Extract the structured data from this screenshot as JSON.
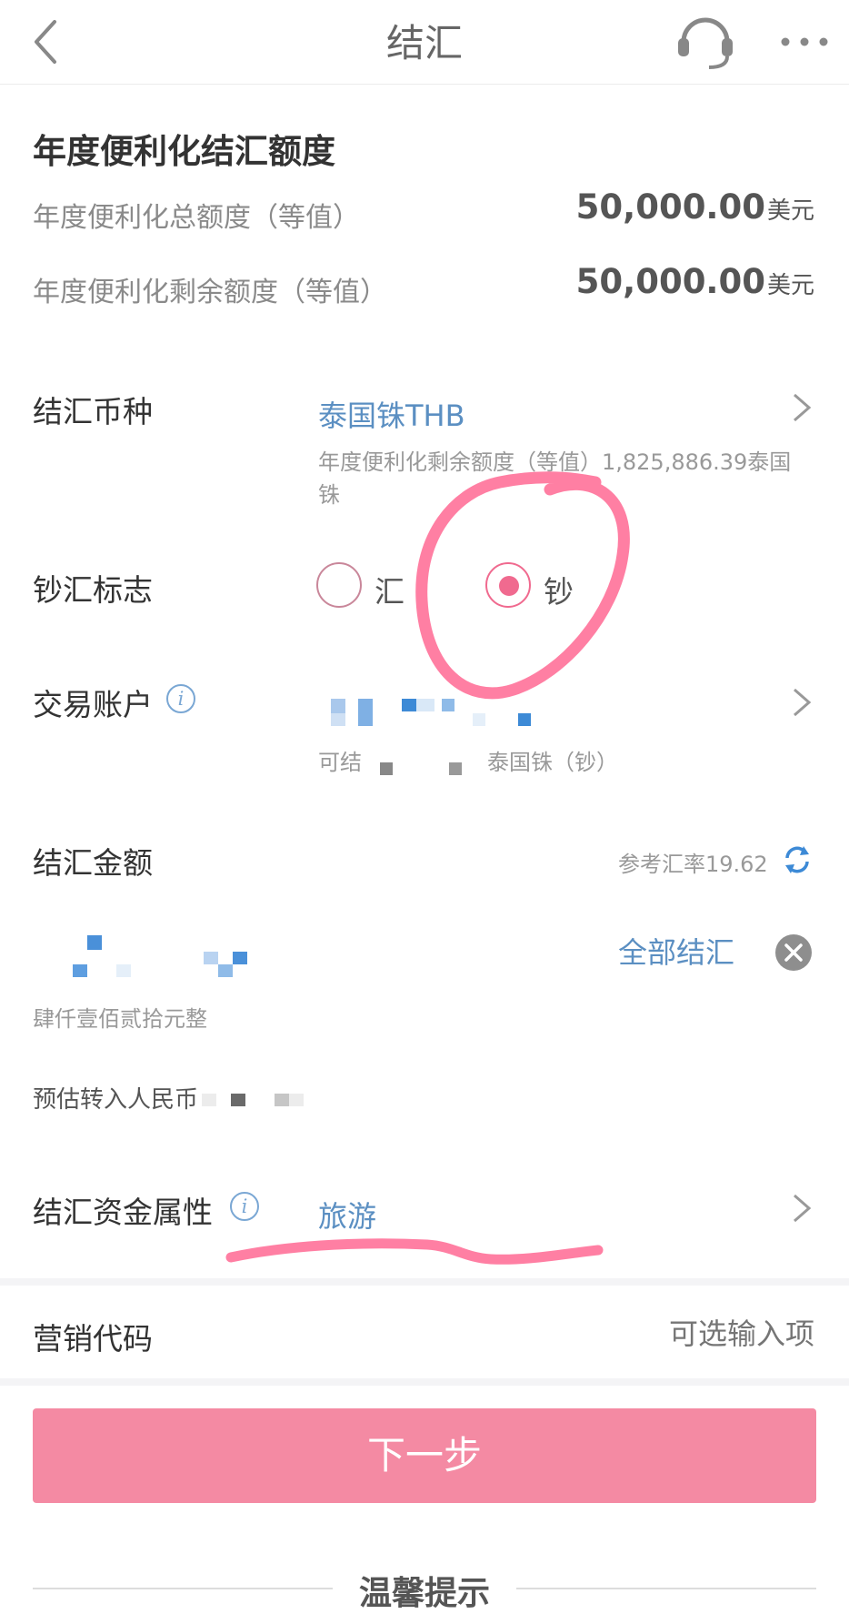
{
  "header": {
    "title": "结汇"
  },
  "quota": {
    "title": "年度便利化结汇额度",
    "total_label": "年度便利化总额度（等值）",
    "total_value": "50,000.00",
    "total_unit": "美元",
    "remaining_label": "年度便利化剩余额度（等值）",
    "remaining_value": "50,000.00",
    "remaining_unit": "美元"
  },
  "currency": {
    "label": "结汇币种",
    "value": "泰国铢THB",
    "note": "年度便利化剩余额度（等值）1,825,886.39泰国铢"
  },
  "cash_flag": {
    "label": "钞汇标志",
    "options": [
      "汇",
      "钞"
    ],
    "selected": "钞"
  },
  "account": {
    "label": "交易账户",
    "note_prefix": "可结",
    "note_suffix": "泰国铢（钞）"
  },
  "amount": {
    "label": "结汇金额",
    "rate_text": "参考汇率19.62",
    "all_button": "全部结汇",
    "in_words": "肆仟壹佰贰拾元整",
    "estimate_label": "预估转入人民币"
  },
  "fund_attr": {
    "label": "结汇资金属性",
    "value": "旅游"
  },
  "promo": {
    "label": "营销代码",
    "placeholder": "可选输入项"
  },
  "next_button": "下一步",
  "tips_title": "温馨提示",
  "colors": {
    "accent_pink": "#f48aa3",
    "link_blue": "#5b8fc2",
    "annotation": "#ff7fa3"
  }
}
